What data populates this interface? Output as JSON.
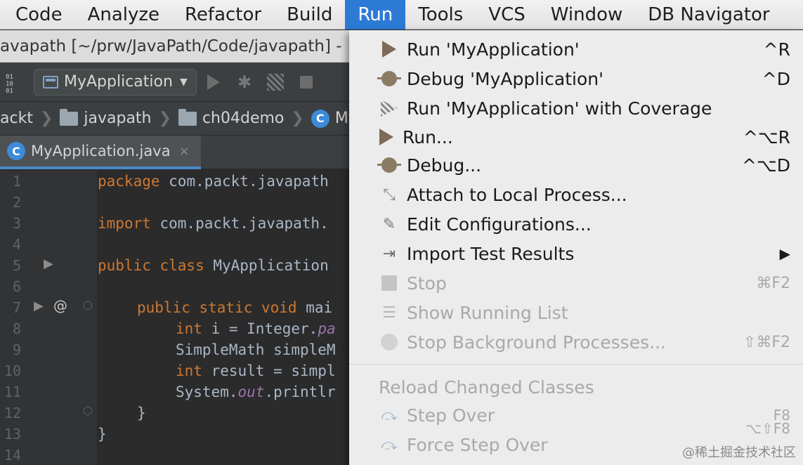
{
  "menubar": {
    "items": [
      "Code",
      "Analyze",
      "Refactor",
      "Build",
      "Run",
      "Tools",
      "VCS",
      "Window",
      "DB Navigator"
    ],
    "active": "Run"
  },
  "ide": {
    "title": "avapath [~/prw/JavaPath/Code/javapath] -",
    "toolbar": {
      "run_config": "MyApplication",
      "binary_icon_text": "01\n10\n01"
    },
    "breadcrumbs": [
      "ackt",
      "javapath",
      "ch04demo",
      "MyA"
    ],
    "tab": {
      "label": "MyApplication.java",
      "close": "×",
      "badge": "C"
    },
    "line_numbers": [
      "1",
      "2",
      "3",
      "4",
      "5",
      "6",
      "7",
      "8",
      "9",
      "10",
      "11",
      "12",
      "13",
      "14"
    ],
    "code": {
      "l1_kw": "package",
      "l1_rest": " com.packt.javapath",
      "l3_kw": "import",
      "l3_rest": " com.packt.javapath.",
      "l5_kw": "public class",
      "l5_rest": " MyApplication",
      "l7_kw": "public static void",
      "l7_rest": " mai",
      "l8_kw": "int",
      "l8_rest": " i = Integer.",
      "l8_it": "pa",
      "l9": "SimpleMath simpleM",
      "l10_kw": "int",
      "l10_rest": " result = simpl",
      "l11_a": "System.",
      "l11_it": "out",
      "l11_b": ".printlr",
      "l12": "}",
      "l13": "}"
    },
    "gutter_annotation": "@"
  },
  "run_menu": {
    "items": [
      {
        "label": "Run 'MyApplication'",
        "shortcut": "^R",
        "icon": "run-icon",
        "enabled": true
      },
      {
        "label": "Debug 'MyApplication'",
        "shortcut": "^D",
        "icon": "debug-icon",
        "enabled": true
      },
      {
        "label": "Run 'MyApplication' with Coverage",
        "shortcut": "",
        "icon": "coverage-icon",
        "enabled": true
      },
      {
        "label": "Run...",
        "shortcut": "^⌥R",
        "icon": "run-icon",
        "enabled": true
      },
      {
        "label": "Debug...",
        "shortcut": "^⌥D",
        "icon": "debug-icon",
        "enabled": true
      },
      {
        "label": "Attach to Local Process...",
        "shortcut": "",
        "icon": "attach-icon",
        "enabled": true
      },
      {
        "label": "Edit Configurations...",
        "shortcut": "",
        "icon": "edit-config-icon",
        "enabled": true
      },
      {
        "label": "Import Test Results",
        "shortcut": "▶",
        "icon": "import-icon",
        "enabled": true
      },
      {
        "label": "Stop",
        "shortcut": "⌘F2",
        "icon": "stop-icon",
        "enabled": false
      },
      {
        "label": "Show Running List",
        "shortcut": "",
        "icon": "list-icon",
        "enabled": false
      },
      {
        "label": "Stop Background Processes...",
        "shortcut": "⇧⌘F2",
        "icon": "stop-bg-icon",
        "enabled": false
      },
      {
        "label": "Reload Changed Classes",
        "shortcut": "",
        "icon": "",
        "enabled": false
      },
      {
        "label": "Step Over",
        "shortcut": "F8",
        "icon": "step-over-icon",
        "enabled": false
      },
      {
        "label": "Force Step Over",
        "shortcut": "⌥⇧F8",
        "icon": "force-step-over-icon",
        "enabled": false
      }
    ]
  },
  "watermark": "@稀土掘金技术社区"
}
